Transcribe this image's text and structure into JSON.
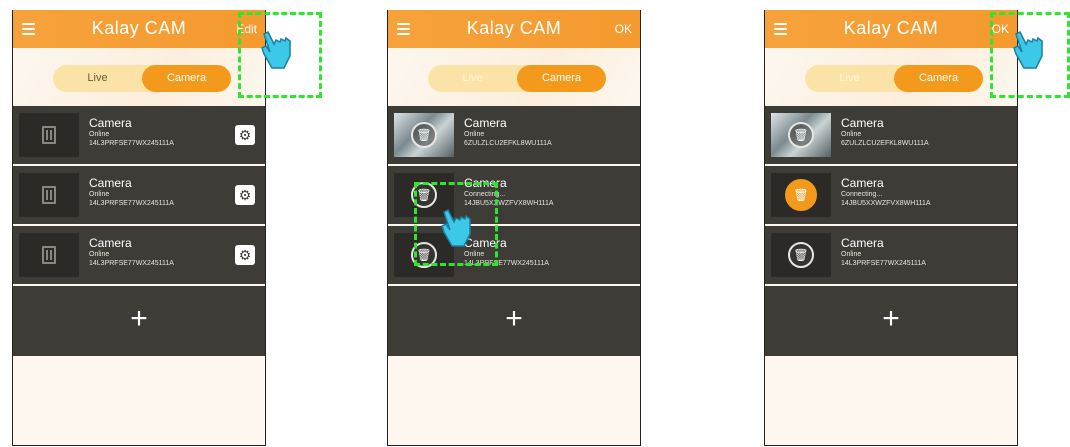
{
  "app": {
    "title": "Kalay CAM",
    "tabs": {
      "live": "Live",
      "camera": "Camera"
    }
  },
  "screens": [
    {
      "action": "Edit",
      "cameras": [
        {
          "name": "Camera",
          "status": "Online",
          "uid": "14L3PRFSE77WX245111A"
        },
        {
          "name": "Camera",
          "status": "Online",
          "uid": "14L3PRFSE77WX245111A"
        },
        {
          "name": "Camera",
          "status": "Online",
          "uid": "14L3PRFSE77WX245111A"
        }
      ],
      "add_label": "+"
    },
    {
      "action": "OK",
      "cameras": [
        {
          "name": "Camera",
          "status": "Online",
          "uid": "6ZULZLCU2EFKL8WU111A"
        },
        {
          "name": "Camera",
          "status": "Connecting...",
          "uid": "14JBU5XXWZFVX8WH111A"
        },
        {
          "name": "Camera",
          "status": "Online",
          "uid": "14L3PRFSE77WX245111A"
        }
      ],
      "add_label": "+"
    },
    {
      "action": "OK",
      "cameras": [
        {
          "name": "Camera",
          "status": "Online",
          "uid": "6ZULZLCU2EFKL8WU111A"
        },
        {
          "name": "Camera",
          "status": "Connecting...",
          "uid": "14JBU5XXWZFVX8WH111A"
        },
        {
          "name": "Camera",
          "status": "Online",
          "uid": "14L3PRFSE77WX245111A"
        }
      ],
      "add_label": "+"
    }
  ],
  "colors": {
    "accent": "#f39a1c",
    "list_bg": "#3e3c37",
    "highlight": "#2ee62e",
    "pointer": "#3cc8e8"
  }
}
